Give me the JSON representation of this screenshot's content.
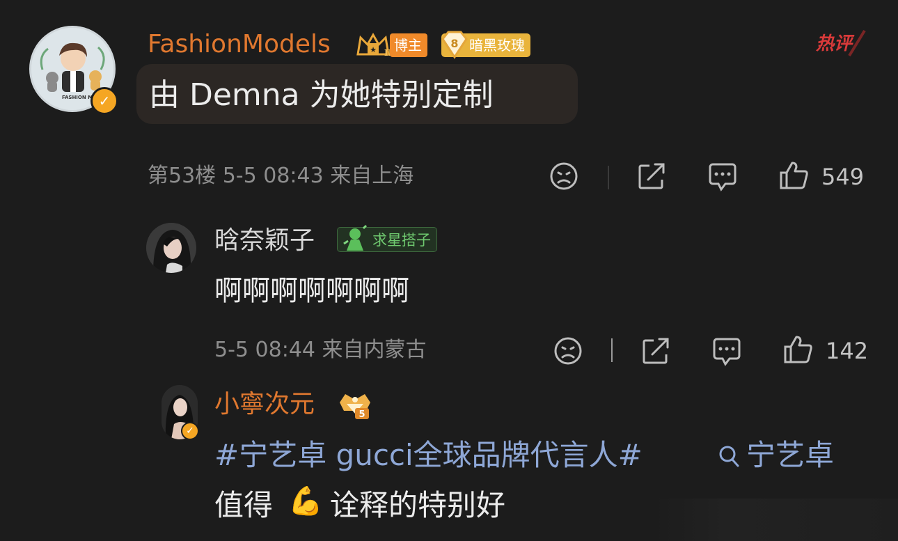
{
  "main_comment": {
    "username": "FashionModels",
    "badge_blogger": "博主",
    "badge_level": "8",
    "badge_title": "暗黑玫瑰",
    "hot_label": "热评",
    "text": "由 Demna 为她特别定制",
    "meta": "第53楼 5-5 08:43 来自上海",
    "likes": "549",
    "avatar_label": "FASHION MODELS"
  },
  "replies": [
    {
      "username": "晗奈颖子",
      "tag": "求星搭子",
      "text": "啊啊啊啊啊啊啊",
      "meta": "5-5 08:44 来自内蒙古",
      "likes": "142"
    },
    {
      "username": "小寧次元",
      "rank_badge": "5",
      "hashtag": "#宁艺卓 gucci全球品牌代言人#",
      "search_link": "宁艺卓",
      "text_before_emoji": "值得",
      "emoji": "💪",
      "text_after_emoji": "诠释的特别好"
    }
  ],
  "colors": {
    "background": "#1c1c1c",
    "username_orange": "#e0782f",
    "link_blue": "#8ea7d6",
    "hot_red": "#d93a3a",
    "verified_gold": "#f5a623"
  },
  "icons": [
    "verified-icon",
    "crown-icon",
    "diamond-icon",
    "dislike-icon",
    "share-icon",
    "comment-icon",
    "like-icon",
    "search-icon",
    "hot-icon"
  ]
}
